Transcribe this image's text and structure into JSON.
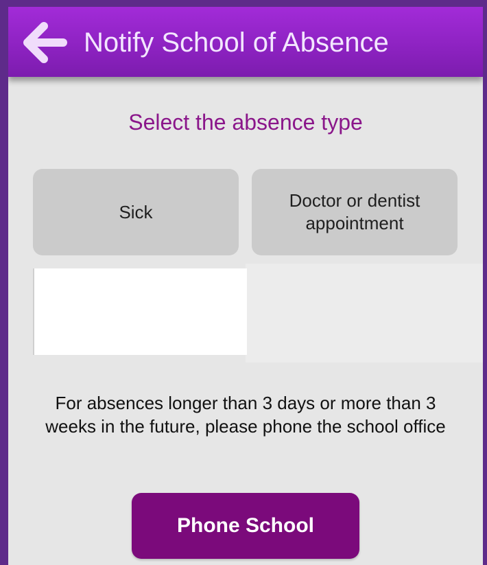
{
  "app_bar": {
    "title": "Notify School of Absence",
    "back_icon": "arrow-left-icon"
  },
  "content": {
    "heading": "Select the absence type",
    "absence_types": [
      {
        "label": "Sick"
      },
      {
        "label": "Doctor or dentist appointment"
      }
    ],
    "notice": "For absences longer than 3 days or more than 3 weeks in the future, please phone the school office",
    "phone_button_label": "Phone School"
  },
  "colors": {
    "app_bar": "#8c22c0",
    "accent_purple": "#7b0a7b",
    "heading_text": "#8a168a",
    "background": "#e6e6e6",
    "type_button": "#cbcbcb"
  }
}
